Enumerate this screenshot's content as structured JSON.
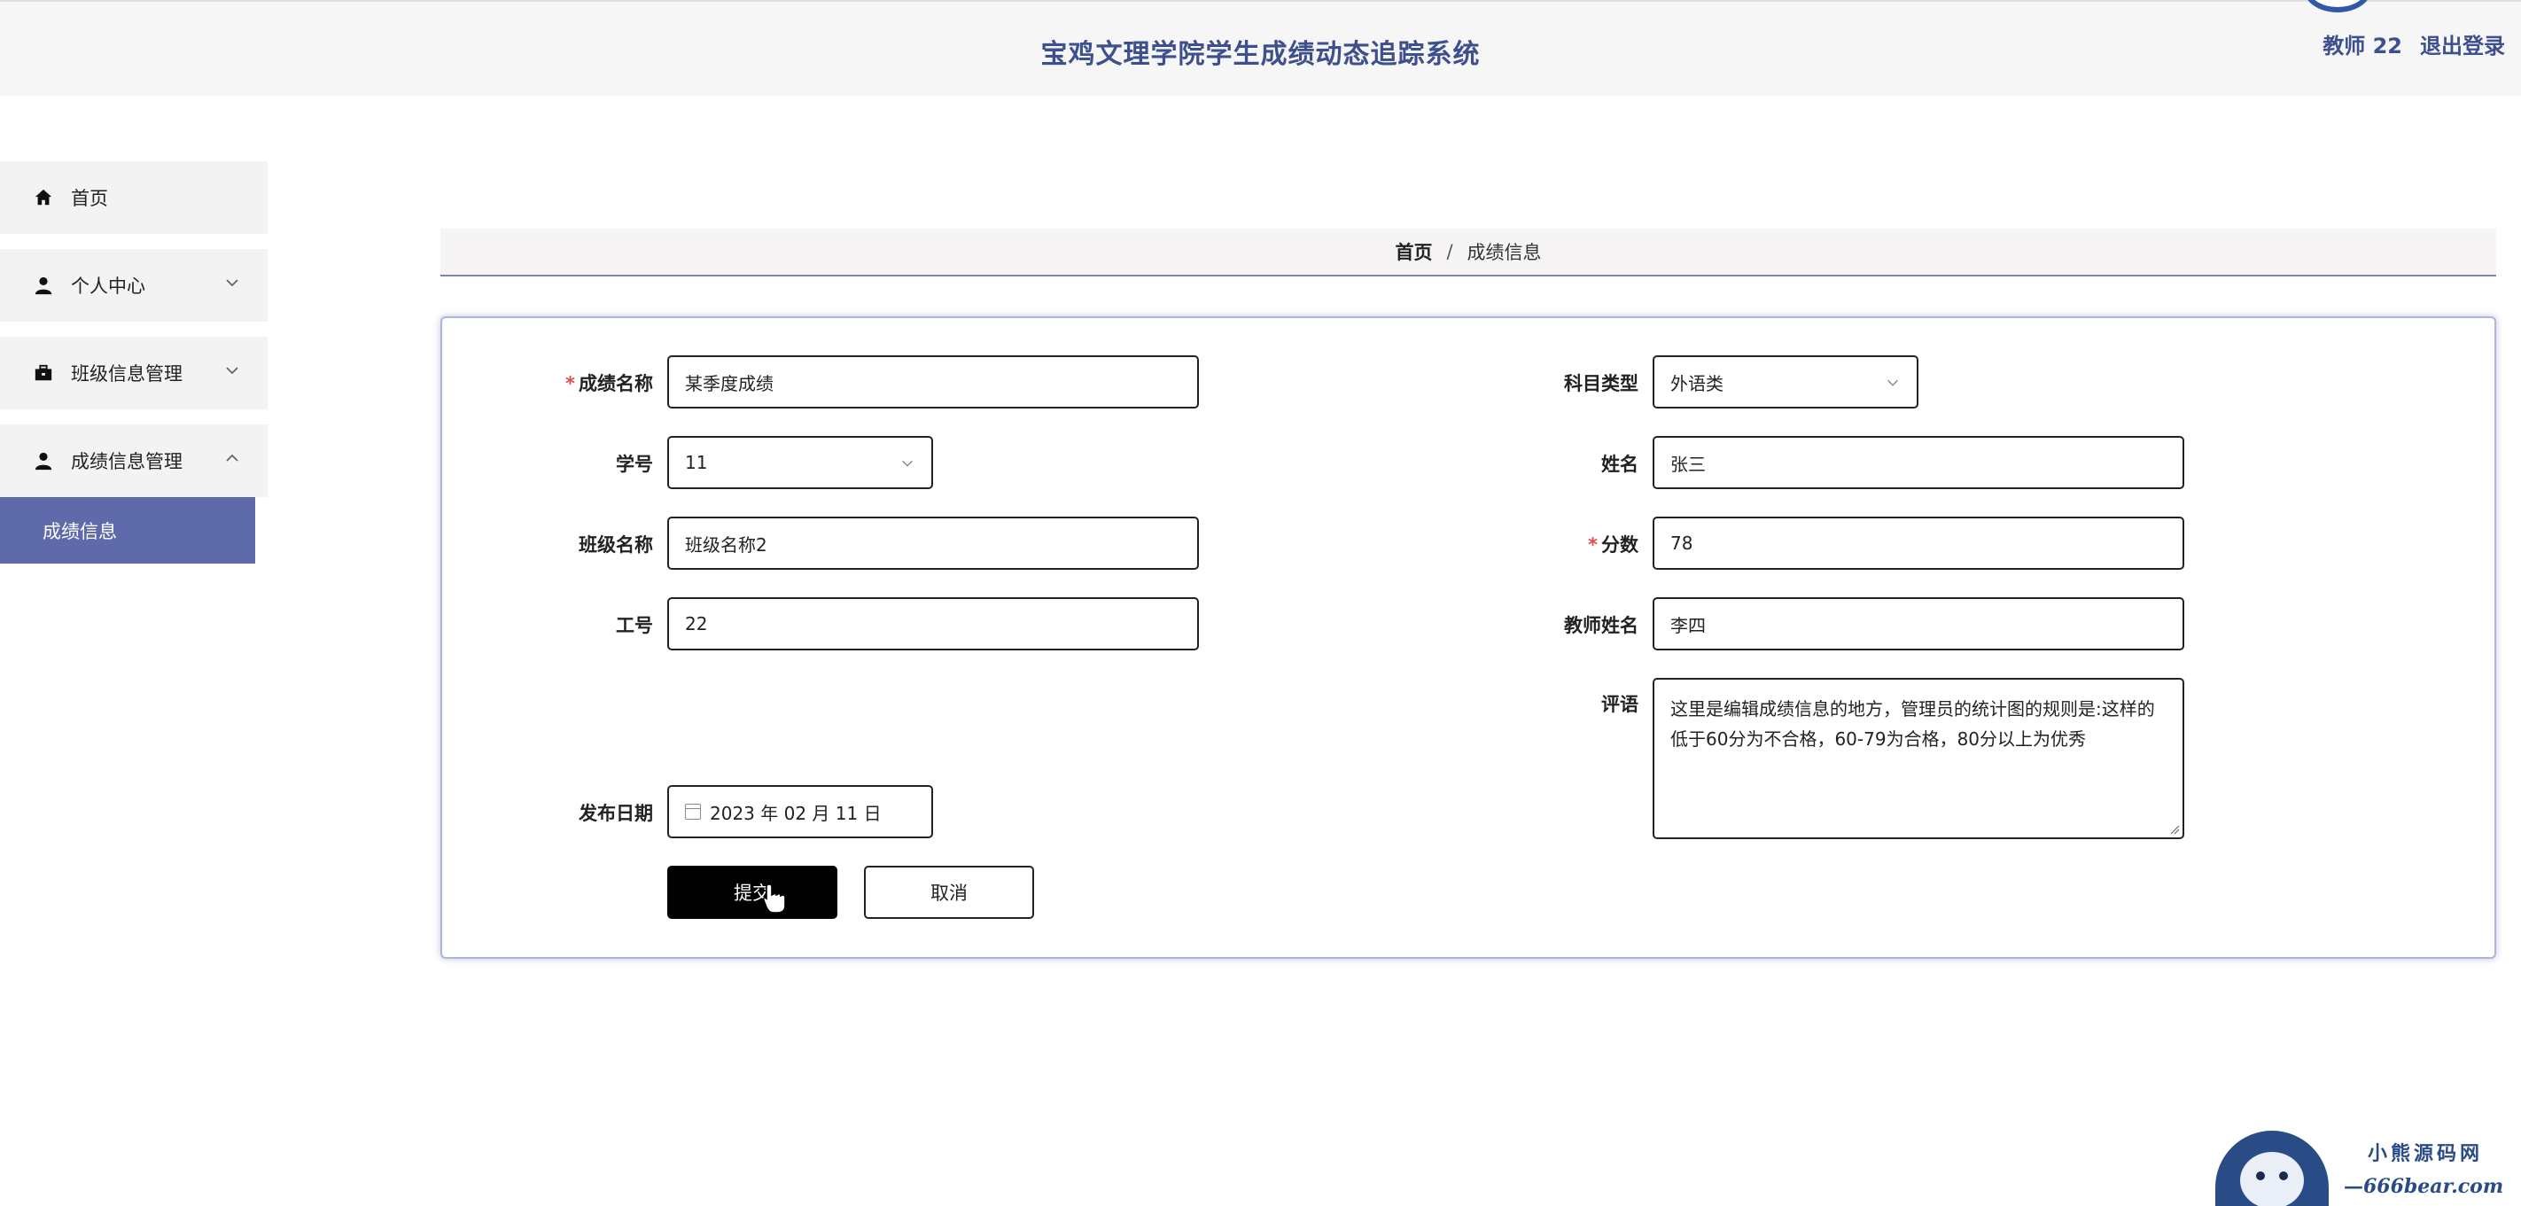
{
  "header": {
    "title": "宝鸡文理学院学生成绩动态追踪系统",
    "user_label": "教师 22",
    "logout_label": "退出登录"
  },
  "sidebar": {
    "items": [
      {
        "label": "首页",
        "icon": "home-icon"
      },
      {
        "label": "个人中心",
        "icon": "user-icon"
      },
      {
        "label": "班级信息管理",
        "icon": "briefcase-icon"
      },
      {
        "label": "成绩信息管理",
        "icon": "user-icon"
      }
    ],
    "active_sub_item": "成绩信息",
    "active_color": "#5f6aab"
  },
  "breadcrumb": {
    "home": "首页",
    "separator": "/",
    "current": "成绩信息"
  },
  "form": {
    "grade_name": {
      "label": "成绩名称",
      "value": "某季度成绩",
      "required": true
    },
    "student_no": {
      "label": "学号",
      "value": "11"
    },
    "class_name": {
      "label": "班级名称",
      "value": "班级名称2"
    },
    "teacher_no": {
      "label": "工号",
      "value": "22"
    },
    "publish_date": {
      "label": "发布日期",
      "value": "2023 年 02 月 11 日"
    },
    "subject_type": {
      "label": "科目类型",
      "value": "外语类"
    },
    "student_name": {
      "label": "姓名",
      "value": "张三"
    },
    "score": {
      "label": "分数",
      "value": "78",
      "required": true
    },
    "teacher_name": {
      "label": "教师姓名",
      "value": "李四"
    },
    "comment": {
      "label": "评语",
      "value": "这里是编辑成绩信息的地方，管理员的统计图的规则是:这样的低于60分为不合格，60-79为合格，80分以上为优秀"
    },
    "required_mark": "*",
    "submit_label": "提交",
    "cancel_label": "取消"
  },
  "watermark": {
    "line1": "小熊源码网",
    "line2": "—666bear.com—"
  }
}
